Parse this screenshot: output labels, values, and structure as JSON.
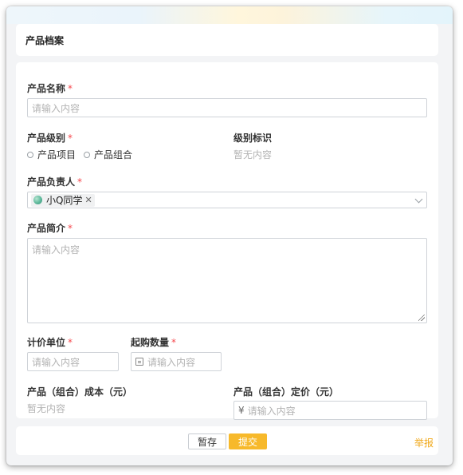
{
  "header": {
    "title": "产品档案"
  },
  "form": {
    "product_name": {
      "label": "产品名称",
      "required": "*",
      "placeholder": "请输入内容"
    },
    "product_level": {
      "label": "产品级别",
      "required": "*",
      "options": [
        "产品项目",
        "产品组合"
      ]
    },
    "level_tag": {
      "label": "级别标识",
      "value": "暂无内容"
    },
    "owner": {
      "label": "产品负责人",
      "required": "*",
      "selected": "小Q同学",
      "icons": {
        "avatar": "avatar-icon",
        "remove": "close-icon",
        "dropdown": "chevron-down-icon"
      }
    },
    "intro": {
      "label": "产品简介",
      "required": "*",
      "placeholder": "请输入内容"
    },
    "unit": {
      "label": "计价单位",
      "required": "*",
      "placeholder": "请输入内容"
    },
    "min_qty": {
      "label": "起购数量",
      "required": "*",
      "placeholder": "请输入内容",
      "icon": "number-input-icon"
    },
    "cost": {
      "label": "产品（组合）成本（元）",
      "value": "暂无内容"
    },
    "price": {
      "label": "产品（组合）定价（元）",
      "prefix": "¥",
      "placeholder": "请输入内容"
    }
  },
  "footer": {
    "save_label": "暂存",
    "submit_label": "提交",
    "report_label": "举报"
  },
  "colors": {
    "required": "#f5484d",
    "primary": "#f7b92b",
    "link": "#f0a81a",
    "placeholder": "#b3b3b3"
  }
}
